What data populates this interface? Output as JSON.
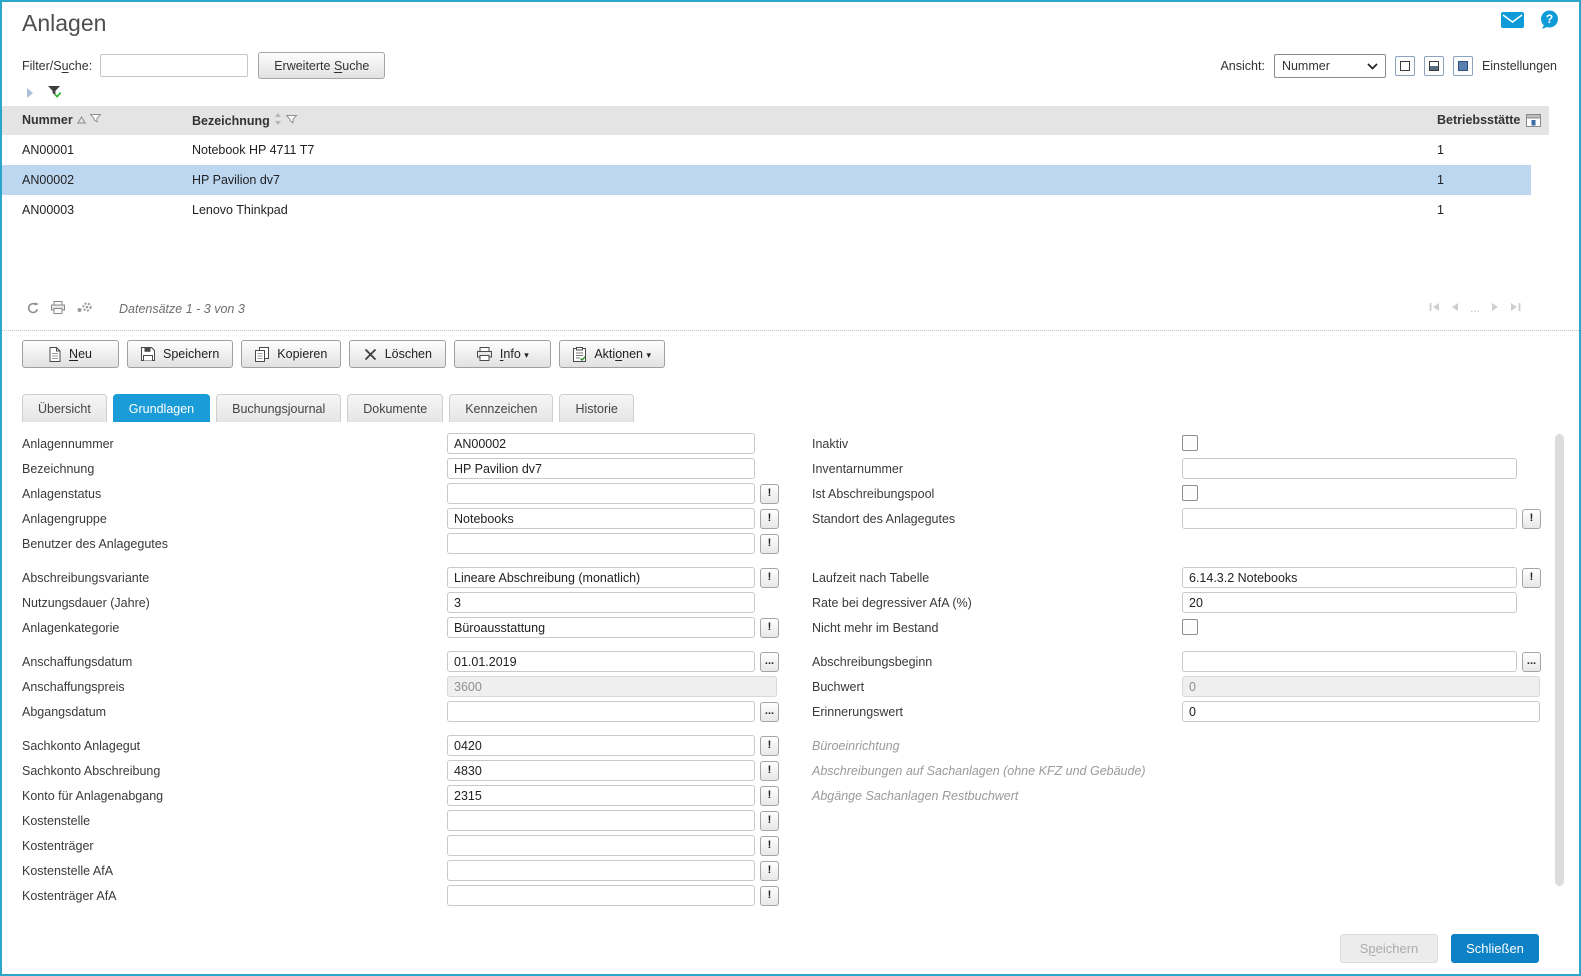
{
  "window": {
    "title": "Anlagen"
  },
  "topbar": {
    "icons": [
      "mail-icon",
      "help-icon"
    ]
  },
  "search": {
    "label": {
      "text": "Filter/Suche:",
      "underline": "u"
    },
    "input_value": "",
    "advanced_button": {
      "text": "Erweiterte Suche",
      "underline": "S"
    }
  },
  "viewbar": {
    "label": "Ansicht:",
    "selected": "Nummer",
    "view_icons": [
      "view-normal-icon",
      "view-split-icon",
      "view-detail-icon"
    ],
    "settings_label": "Einstellungen"
  },
  "filterbar": {
    "icons": [
      "expand-arrow-icon",
      "filter-active-icon"
    ]
  },
  "list": {
    "columns": [
      {
        "label": "Nummer",
        "sort": "asc"
      },
      {
        "label": "Bezeichnung",
        "sort": "none"
      },
      {
        "label": "Betriebsstätte"
      }
    ],
    "rows": [
      {
        "nummer": "AN00001",
        "bezeichnung": "Notebook HP 4711 T7",
        "betriebsstaette": "1",
        "selected": false
      },
      {
        "nummer": "AN00002",
        "bezeichnung": "HP Pavilion dv7",
        "betriebsstaette": "1",
        "selected": true
      },
      {
        "nummer": "AN00003",
        "bezeichnung": "Lenovo Thinkpad",
        "betriebsstaette": "1",
        "selected": false
      }
    ],
    "status": "Datensätze 1 - 3 von 3",
    "pagination": {
      "ellipsis": "..."
    }
  },
  "toolbar": {
    "buttons": [
      {
        "label": "Neu",
        "underline": "N",
        "icon": "new-document-icon"
      },
      {
        "label": "Speichern",
        "icon": "save-icon"
      },
      {
        "label": "Kopieren",
        "icon": "copy-icon"
      },
      {
        "label": "Löschen",
        "icon": "delete-icon"
      },
      {
        "label": "Info",
        "underline": "I",
        "icon": "print-icon",
        "dropdown": true
      },
      {
        "label": "Aktionen",
        "underline": "o",
        "icon": "actions-icon",
        "dropdown": true
      }
    ]
  },
  "tabs": [
    {
      "label": "Übersicht"
    },
    {
      "label": "Grundlagen",
      "active": true
    },
    {
      "label": "Buchungsjournal"
    },
    {
      "label": "Dokumente"
    },
    {
      "label": "Kennzeichen"
    },
    {
      "label": "Historie"
    }
  ],
  "form": {
    "left": [
      {
        "label": "Anlagennummer",
        "value": "AN00002",
        "type": "input"
      },
      {
        "label": "Bezeichnung",
        "value": "HP Pavilion dv7",
        "type": "input"
      },
      {
        "label": "Anlagenstatus",
        "value": "",
        "type": "lookup"
      },
      {
        "label": "Anlagengruppe",
        "value": "Notebooks",
        "type": "lookup"
      },
      {
        "label": "Benutzer des Anlagegutes",
        "value": "",
        "type": "lookup"
      },
      {
        "type": "gap"
      },
      {
        "label": "Abschreibungsvariante",
        "value": "Lineare Abschreibung (monatlich)",
        "type": "lookup"
      },
      {
        "label": "Nutzungsdauer (Jahre)",
        "value": "3",
        "type": "input"
      },
      {
        "label": "Anlagenkategorie",
        "value": "Büroausstattung",
        "type": "lookup"
      },
      {
        "type": "gap"
      },
      {
        "label": "Anschaffungsdatum",
        "value": "01.01.2019",
        "type": "date"
      },
      {
        "label": "Anschaffungspreis",
        "value": "3600",
        "type": "input",
        "readonly": true,
        "wide": true
      },
      {
        "label": "Abgangsdatum",
        "value": "",
        "type": "date"
      },
      {
        "type": "gap"
      },
      {
        "label": "Sachkonto Anlagegut",
        "value": "0420",
        "type": "lookup"
      },
      {
        "label": "Sachkonto Abschreibung",
        "value": "4830",
        "type": "lookup"
      },
      {
        "label": "Konto für Anlagenabgang",
        "value": "2315",
        "type": "lookup"
      },
      {
        "label": "Kostenstelle",
        "value": "",
        "type": "lookup"
      },
      {
        "label": "Kostenträger",
        "value": "",
        "type": "lookup"
      },
      {
        "label": "Kostenstelle AfA",
        "value": "",
        "type": "lookup"
      },
      {
        "label": "Kostenträger AfA",
        "value": "",
        "type": "lookup"
      }
    ],
    "right": [
      {
        "label": "Inaktiv",
        "type": "checkbox",
        "checked": false
      },
      {
        "label": "Inventarnummer",
        "value": "",
        "type": "input"
      },
      {
        "label": "Ist Abschreibungspool",
        "type": "checkbox",
        "checked": false
      },
      {
        "label": "Standort des Anlagegutes",
        "value": "",
        "type": "lookup"
      },
      {
        "type": "spacer"
      },
      {
        "type": "gap"
      },
      {
        "label": "Laufzeit nach Tabelle",
        "value": "6.14.3.2 Notebooks",
        "type": "lookup"
      },
      {
        "label": "Rate bei degressiver AfA (%)",
        "value": "20",
        "type": "input"
      },
      {
        "label": "Nicht mehr im Bestand",
        "type": "checkbox",
        "checked": false
      },
      {
        "type": "gap"
      },
      {
        "label": "Abschreibungsbeginn",
        "value": "",
        "type": "date"
      },
      {
        "label": "Buchwert",
        "value": "0",
        "type": "input",
        "readonly": true,
        "wide": true
      },
      {
        "label": "Erinnerungswert",
        "value": "0",
        "type": "input",
        "wide": true
      },
      {
        "type": "gap"
      },
      {
        "type": "note",
        "text": "Büroeinrichtung"
      },
      {
        "type": "note",
        "text": "Abschreibungen auf Sachanlagen (ohne KFZ und Gebäude)"
      },
      {
        "type": "note",
        "text": "Abgänge Sachanlagen Restbuchwert"
      }
    ]
  },
  "footer": {
    "save": {
      "text": "Speichern",
      "underline": "p",
      "disabled": true
    },
    "close": {
      "text": "Schließen"
    }
  },
  "colors": {
    "window_border": "#2ea6c9",
    "accent_blue": "#199cd8",
    "close_button_blue": "#0d82c6",
    "selected_row": "#bdd7f1",
    "table_header_bg": "#e4e4e4"
  }
}
